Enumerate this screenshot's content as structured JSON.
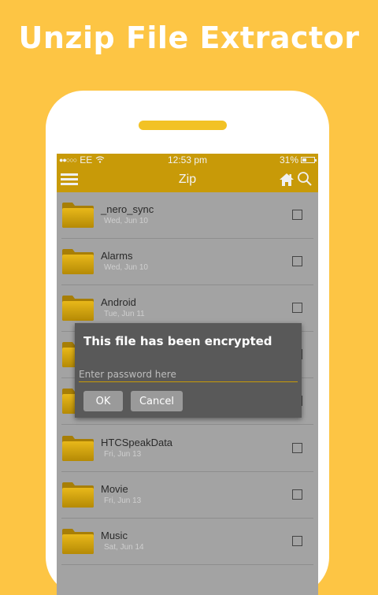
{
  "headline": "Unzip File Extractor",
  "status_bar": {
    "carrier": "EE",
    "time": "12:53 pm",
    "battery": "31%",
    "battery_level": 0.31
  },
  "toolbar": {
    "title": "Zip",
    "menu_icon": "hamburger-menu-icon",
    "home_icon": "home-icon",
    "search_icon": "search-icon"
  },
  "files": [
    {
      "name": "_nero_sync",
      "date": "Wed, Jun 10"
    },
    {
      "name": "Alarms",
      "date": "Wed, Jun 10"
    },
    {
      "name": "Android",
      "date": "Tue, Jun 11"
    },
    {
      "name": "",
      "date": ""
    },
    {
      "name": "",
      "date": ""
    },
    {
      "name": "HTCSpeakData",
      "date": "Fri, Jun 13"
    },
    {
      "name": "Movie",
      "date": "Fri, Jun 13"
    },
    {
      "name": "Music",
      "date": "Sat, Jun 14"
    }
  ],
  "dialog": {
    "title": "This file has been encrypted",
    "password_placeholder": "Enter password here",
    "password_value": "",
    "ok_label": "OK",
    "cancel_label": "Cancel"
  },
  "colors": {
    "background": "#FDC544",
    "toolbar": "#C89A08",
    "accent": "#F2C225"
  }
}
